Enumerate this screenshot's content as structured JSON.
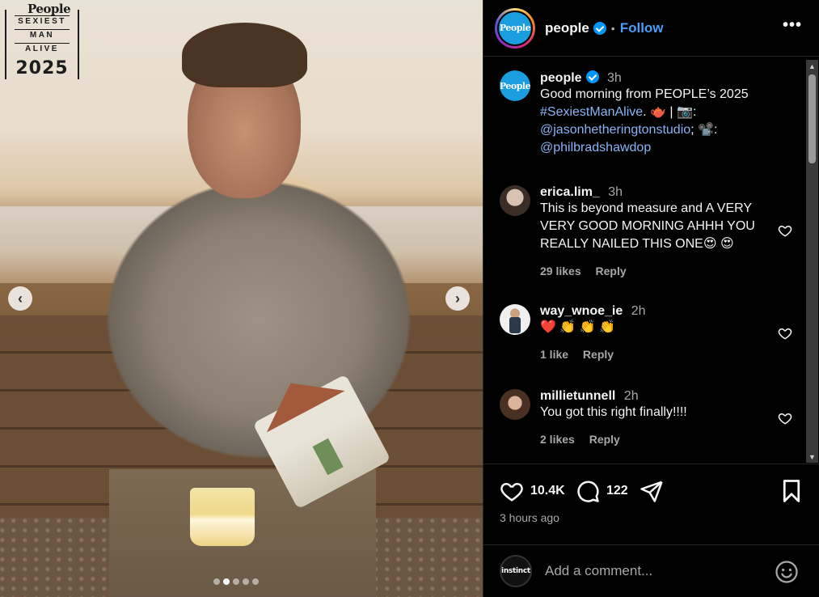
{
  "post_image": {
    "badge": {
      "brand": "People",
      "line1": "SEXIEST",
      "line2": "MAN",
      "line3": "ALIVE",
      "year": "2025"
    },
    "prev_symbol": "‹",
    "next_symbol": "›",
    "carousel_count": 5,
    "carousel_active": 2
  },
  "header": {
    "username": "people",
    "avatar_text": "People",
    "bullet": "•",
    "follow_label": "Follow",
    "more_label": "•••"
  },
  "caption": {
    "username": "people",
    "time": "3h",
    "text_start": "Good morning from PEOPLE’s 2025 ",
    "hashtag": "#SexiestManAlive",
    "mid": ". 🫖 | 📷: ",
    "mention1": "@jasonhetheringtonstudio",
    "mid2": "; 📽️: ",
    "mention2": "@philbradshawdop"
  },
  "comments": [
    {
      "username": "erica.lim_",
      "time": "3h",
      "text": "This is beyond measure and A VERY VERY GOOD MORNING AHHH YOU REALLY NAILED THIS ONE😍 😍",
      "likes": "29 likes",
      "reply": "Reply"
    },
    {
      "username": "way_wnoe_ie",
      "time": "2h",
      "text": "❤️ 👏 👏 👏",
      "likes": "1 like",
      "reply": "Reply"
    },
    {
      "username": "millietunnell",
      "time": "2h",
      "text": "You got this right finally!!!!",
      "likes": "2 likes",
      "reply": "Reply"
    }
  ],
  "actions": {
    "like_count": "10.4K",
    "comment_count": "122",
    "timestamp": "3 hours ago"
  },
  "composer": {
    "avatar_text": "instinct",
    "placeholder": "Add a comment..."
  },
  "scrollbar": {
    "up": "▲",
    "down": "▼"
  },
  "colors": {
    "accent_link": "#8ab4f8",
    "follow": "#4a9df8",
    "verified": "#0095f6",
    "background": "#000000",
    "muted_text": "#a8a8a8"
  },
  "icons": [
    "heart-icon",
    "comment-icon",
    "share-icon",
    "bookmark-icon",
    "emoji-icon",
    "verified-badge-icon",
    "more-icon"
  ]
}
